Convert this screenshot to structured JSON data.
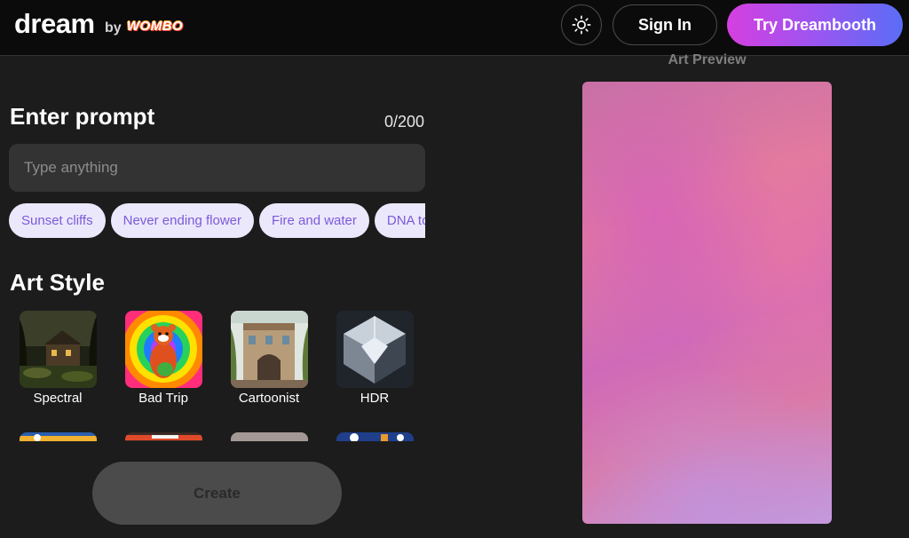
{
  "header": {
    "logo_word": "dream",
    "logo_by": "by",
    "logo_brand": "WOMBO",
    "theme_icon": "sun-icon",
    "signin_label": "Sign In",
    "dreambooth_label": "Try Dreambooth"
  },
  "prompt": {
    "title": "Enter prompt",
    "counter": "0/200",
    "placeholder": "Type anything",
    "value": "",
    "suggestions": [
      "Sunset cliffs",
      "Never ending flower",
      "Fire and water",
      "DNA torna"
    ]
  },
  "art_style": {
    "title": "Art Style",
    "styles": [
      {
        "label": "Spectral",
        "icon": "spectral-thumbnail"
      },
      {
        "label": "Bad Trip",
        "icon": "bad-trip-thumbnail"
      },
      {
        "label": "Cartoonist",
        "icon": "cartoonist-thumbnail"
      },
      {
        "label": "HDR",
        "icon": "hdr-thumbnail"
      }
    ]
  },
  "create_label": "Create",
  "preview": {
    "label": "Art Preview"
  },
  "colors": {
    "accent_gradient_start": "#d63fe0",
    "accent_gradient_end": "#5a6df7",
    "chip_bg": "#ece8fc",
    "chip_text": "#7b5ad9",
    "background": "#1c1c1c"
  }
}
